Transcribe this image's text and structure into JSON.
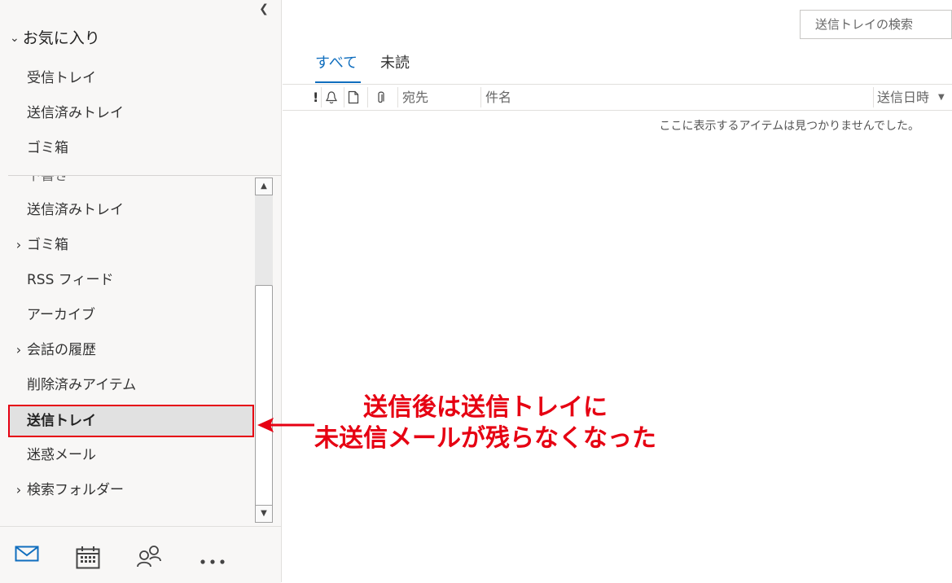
{
  "favorites": {
    "header": "お気に入り",
    "items": [
      "受信トレイ",
      "送信済みトレイ",
      "ゴミ箱"
    ]
  },
  "folders": {
    "partial_item": "下書き",
    "items": [
      {
        "label": "送信済みトレイ",
        "expandable": false
      },
      {
        "label": "ゴミ箱",
        "expandable": true
      },
      {
        "label": "RSS フィード",
        "expandable": false
      },
      {
        "label": "アーカイブ",
        "expandable": false
      },
      {
        "label": "会話の履歴",
        "expandable": true
      },
      {
        "label": "削除済みアイテム",
        "expandable": false
      },
      {
        "label": "送信トレイ",
        "expandable": false,
        "selected": true
      },
      {
        "label": "迷惑メール",
        "expandable": false
      },
      {
        "label": "検索フォルダー",
        "expandable": true
      }
    ]
  },
  "search": {
    "placeholder": "送信トレイの検索"
  },
  "tabs": {
    "all": "すべて",
    "unread": "未読"
  },
  "columns": {
    "importance": "!",
    "to": "宛先",
    "subject": "件名",
    "sent": "送信日時"
  },
  "message_list": {
    "empty_text": "ここに表示するアイテムは見つかりませんでした。"
  },
  "annotation": {
    "line1": "送信後は送信トレイに",
    "line2": "未送信メールが残らなくなった"
  },
  "colors": {
    "accent": "#106ebe",
    "annotation": "#e60012"
  }
}
